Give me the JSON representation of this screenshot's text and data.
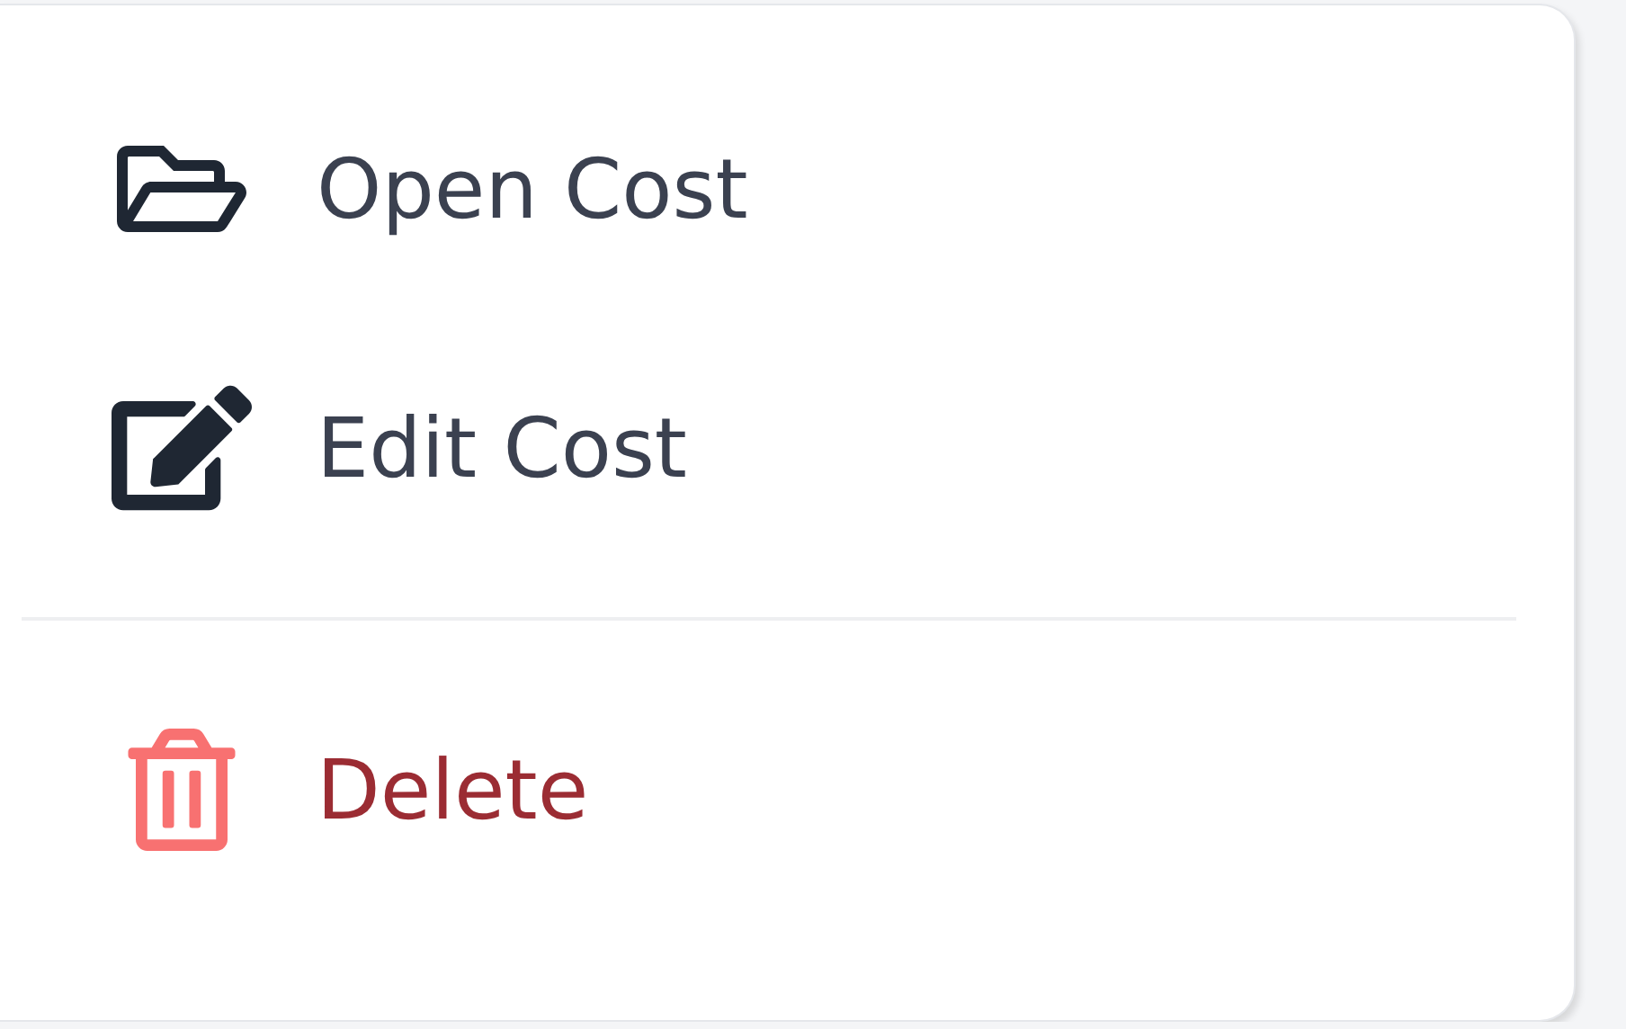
{
  "menu": {
    "groups": [
      [
        {
          "label": "Open Cost",
          "kind": "open"
        },
        {
          "label": "Edit Cost",
          "kind": "edit"
        }
      ],
      [
        {
          "label": "Delete",
          "kind": "delete"
        }
      ]
    ]
  }
}
